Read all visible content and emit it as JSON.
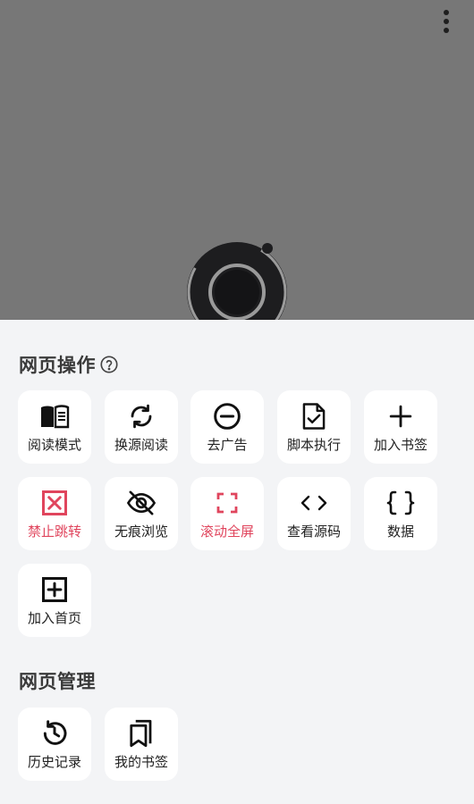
{
  "sections": {
    "web_actions": {
      "title": "网页操作",
      "items": [
        {
          "label": "阅读模式",
          "icon": "book-open-icon"
        },
        {
          "label": "换源阅读",
          "icon": "refresh-icon"
        },
        {
          "label": "去广告",
          "icon": "minus-circle-icon"
        },
        {
          "label": "脚本执行",
          "icon": "file-check-icon"
        },
        {
          "label": "加入书签",
          "icon": "plus-icon"
        },
        {
          "label": "禁止跳转",
          "icon": "x-square-icon",
          "state": "active",
          "color": "#e0455d"
        },
        {
          "label": "无痕浏览",
          "icon": "eye-off-icon"
        },
        {
          "label": "滚动全屏",
          "icon": "fullscreen-icon",
          "state": "active",
          "color": "#e0455d"
        },
        {
          "label": "查看源码",
          "icon": "code-icon"
        },
        {
          "label": "数据",
          "icon": "braces-icon"
        },
        {
          "label": "加入首页",
          "icon": "plus-square-icon"
        }
      ]
    },
    "web_manage": {
      "title": "网页管理",
      "items": [
        {
          "label": "历史记录",
          "icon": "history-icon"
        },
        {
          "label": "我的书签",
          "icon": "bookmarks-icon"
        }
      ]
    }
  },
  "colors": {
    "overlay": "#777777",
    "sheet": "#f3f4f6",
    "tile": "#ffffff",
    "active": "#e0455d"
  }
}
